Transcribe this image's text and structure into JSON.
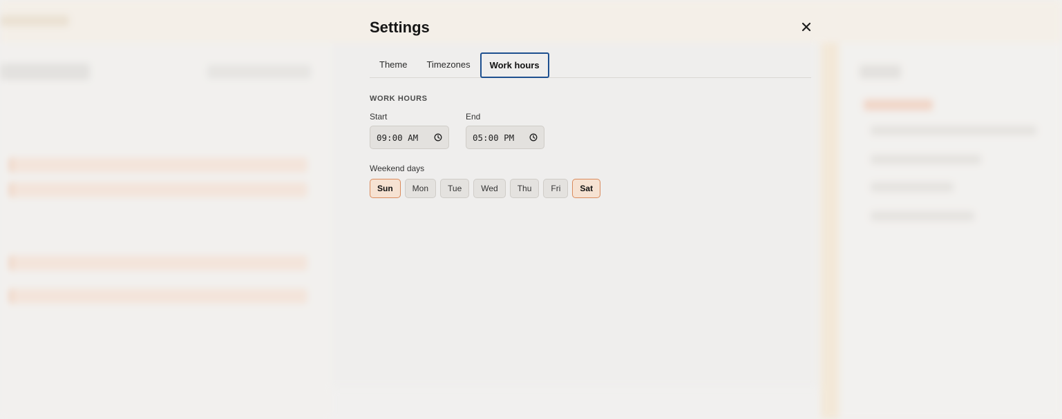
{
  "modal": {
    "title": "Settings",
    "tabs": [
      {
        "label": "Theme",
        "active": false
      },
      {
        "label": "Timezones",
        "active": false
      },
      {
        "label": "Work hours",
        "active": true
      }
    ],
    "work_hours": {
      "section_title": "WORK HOURS",
      "start": {
        "label": "Start",
        "value": "09:00 AM"
      },
      "end": {
        "label": "End",
        "value": "05:00 PM"
      },
      "weekend_label": "Weekend days",
      "days": [
        {
          "label": "Sun",
          "selected": true
        },
        {
          "label": "Mon",
          "selected": false
        },
        {
          "label": "Tue",
          "selected": false
        },
        {
          "label": "Wed",
          "selected": false
        },
        {
          "label": "Thu",
          "selected": false
        },
        {
          "label": "Fri",
          "selected": false
        },
        {
          "label": "Sat",
          "selected": true
        }
      ]
    }
  },
  "icons": {
    "close": "close-icon",
    "clock": "clock-icon"
  },
  "colors": {
    "active_tab_border": "#1d4f8f",
    "selected_day_bg": "#f6e2d2",
    "selected_day_border": "#d98a5c"
  }
}
